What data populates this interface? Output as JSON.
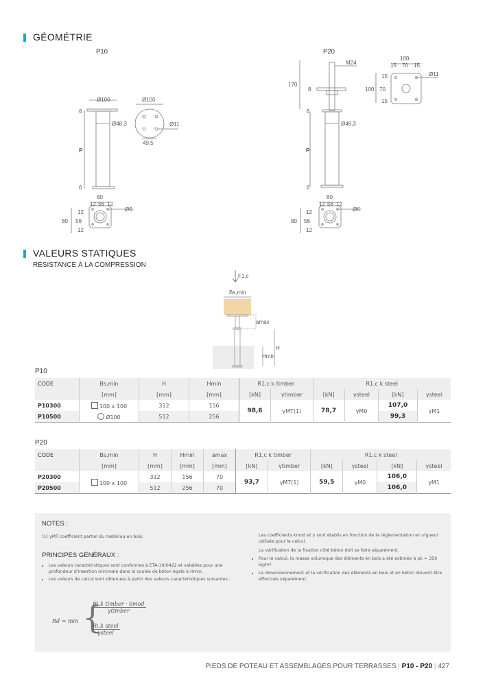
{
  "sections": {
    "geometry_title": "GÉOMÉTRIE",
    "static_title": "VALEURS STATIQUES",
    "static_subtitle": "RÉSISTANCE À LA COMPRESSION"
  },
  "geometry": {
    "p10": {
      "label": "P10",
      "dims": {
        "plate_d": "Ø100",
        "top_d": "Ø100",
        "tube_d": "Ø48,3",
        "hole_d": "Ø11",
        "spacing": "49,5",
        "top_t": "6",
        "bottom_t": "6",
        "height": "P",
        "base_w": "80",
        "base_a": "12",
        "base_b": "56",
        "base_c": "12",
        "base_hole": "Ø6",
        "base_h": "80",
        "side_a": "12",
        "side_b": "56",
        "side_c": "12"
      }
    },
    "p20": {
      "label": "P20",
      "dims": {
        "thread": "M24",
        "total": "170",
        "plate_t": "8",
        "tube_d": "Ø48,3",
        "top_t": "6",
        "bottom_t": "6",
        "height": "P",
        "plate_w": "100",
        "plate_a": "15",
        "plate_b": "70",
        "plate_c": "15",
        "plate_hole": "Ø11",
        "plate_h": "100",
        "pside_a": "15",
        "pside_b": "70",
        "pside_c": "15",
        "base_w": "80",
        "base_a": "12",
        "base_b": "56",
        "base_c": "12",
        "base_hole": "Ø6",
        "base_h": "80",
        "side_a": "12",
        "side_b": "56",
        "side_c": "12"
      }
    }
  },
  "diagram": {
    "force": "F1,c",
    "bs": "Bs,min",
    "amax": "amax",
    "h": "H",
    "hmin": "Hmin"
  },
  "table_p10": {
    "title": "P10",
    "headers": [
      "CODE",
      "Bs,min",
      "H",
      "Hmin",
      "R1,c k timber",
      "R1,c k steel"
    ],
    "units": [
      "[mm]",
      "[mm]",
      "[mm]",
      "[kN]",
      "γtimber",
      "[kN]",
      "γsteel",
      "[kN]",
      "γsteel"
    ],
    "rows": [
      {
        "code": "P10300",
        "bs": "100 x 100",
        "h": "312",
        "hmin": "156",
        "steel2": "107,0"
      },
      {
        "code": "P10500",
        "bs": "Ø100",
        "h": "512",
        "hmin": "256",
        "steel2": "99,3"
      }
    ],
    "timber_kn": "98,6",
    "timber_gamma": "γMT(1)",
    "steel_kn": "78,7",
    "steel_gamma": "γM0",
    "steel_gamma2": "γM1"
  },
  "table_p20": {
    "title": "P20",
    "headers": [
      "CODE",
      "Bs,min",
      "H",
      "Hmin",
      "amax",
      "R1,c k timber",
      "R1,c k steel"
    ],
    "units": [
      "[mm]",
      "[mm]",
      "[mm]",
      "[mm]",
      "[kN]",
      "γtimber",
      "[kN]",
      "γsteel",
      "[kN]",
      "γsteel"
    ],
    "rows": [
      {
        "code": "P20300",
        "h": "312",
        "hmin": "156",
        "amax": "70",
        "steel2": "106,0"
      },
      {
        "code": "P20500",
        "h": "512",
        "hmin": "256",
        "amax": "70",
        "steel2": "106,0"
      }
    ],
    "bs": "100 x 100",
    "timber_kn": "93,7",
    "timber_gamma": "γMT(1)",
    "steel_kn": "59,5",
    "steel_gamma": "γM0",
    "steel_gamma2": "γM1"
  },
  "notes": {
    "title": "NOTES :",
    "footnote": "(1) γMT coefficient partiel du matériau en bois.",
    "principles_title": "PRINCIPES GÉNÉRAUX :",
    "bullets_left": [
      "Les valeurs caractéristiques sont conformes à ETA-10/0422 et valables pour une profondeur d'insertion minimale dans la coulée de béton égale à Hmin.",
      "Les valeurs de calcul sont obtenues à partir des valeurs caractéristiques suivantes :"
    ],
    "formula": {
      "lhs": "Rd = min",
      "num1": "Ri,k timber · kmod",
      "den1": "γtimber",
      "num2": "Ri,k steel",
      "den2": "γsteel"
    },
    "right_p1": "Les coefficients kmod et γ sont établis en fonction de la réglementation en vigueur utilisée pour le calcul.",
    "right_p2": "La vérification de la fixation côté béton doit se faire séparément.",
    "bullets_right": [
      "Pour le calcul, la masse volumique des éléments en bois a été estimée à ρk = 350 kg/m³.",
      "Le dimensionnement et la vérification des éléments en bois et en béton doivent être effectués séparément."
    ]
  },
  "footer": {
    "title": "PIEDS DE POTEAU ET ASSEMBLAGES POUR TERRASSES",
    "product": "P10 - P20",
    "page": "427"
  }
}
